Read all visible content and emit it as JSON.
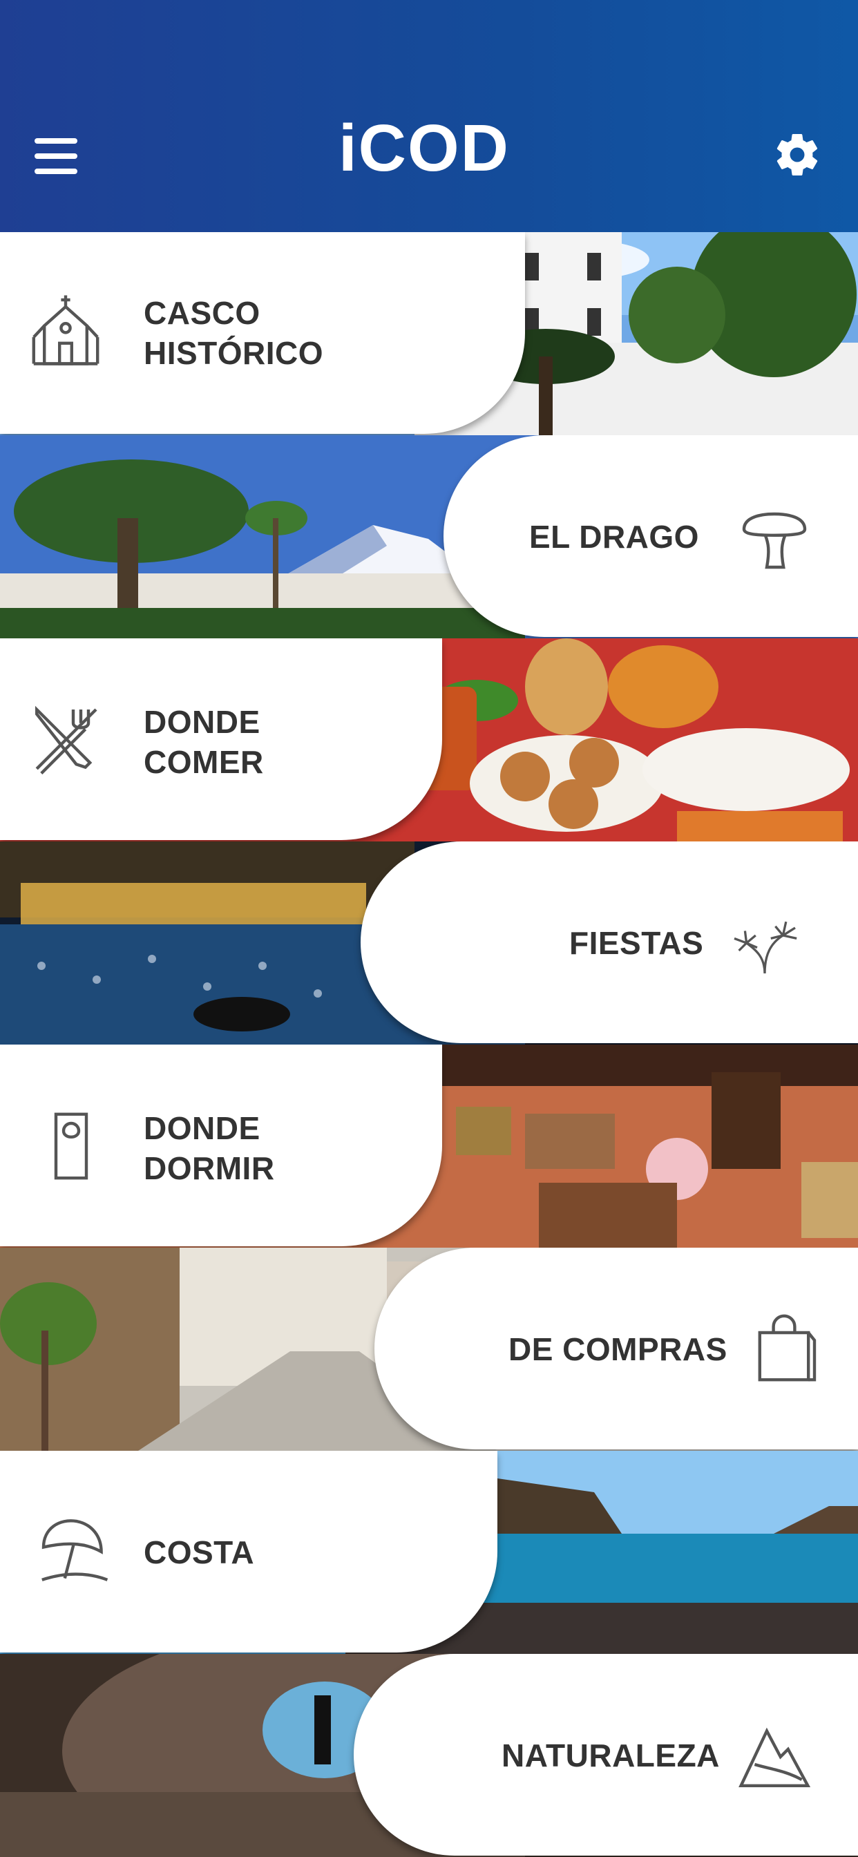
{
  "header": {
    "logo_text": "iCOD",
    "colors": {
      "bar_start": "#1f3f93",
      "bar_end": "#0f58a6",
      "logo_green": "#8cc63f",
      "logo_orange": "#e86a1f"
    },
    "icons": {
      "menu": "hamburger-menu-icon",
      "settings": "gear-icon"
    }
  },
  "menu": [
    {
      "label": "CASCO\nHISTÓRICO",
      "icon": "church-icon",
      "align": "left"
    },
    {
      "label": "EL DRAGO",
      "icon": "dragon-tree-icon",
      "align": "right"
    },
    {
      "label": "DONDE\nCOMER",
      "icon": "fork-knife-icon",
      "align": "left"
    },
    {
      "label": "FIESTAS",
      "icon": "fireworks-icon",
      "align": "right"
    },
    {
      "label": "DONDE\nDORMIR",
      "icon": "door-hanger-icon",
      "align": "left"
    },
    {
      "label": "DE COMPRAS",
      "icon": "shopping-bag-icon",
      "align": "right"
    },
    {
      "label": "COSTA",
      "icon": "beach-umbrella-icon",
      "align": "left"
    },
    {
      "label": "NATURALEZA",
      "icon": "mountain-icon",
      "align": "right"
    }
  ]
}
